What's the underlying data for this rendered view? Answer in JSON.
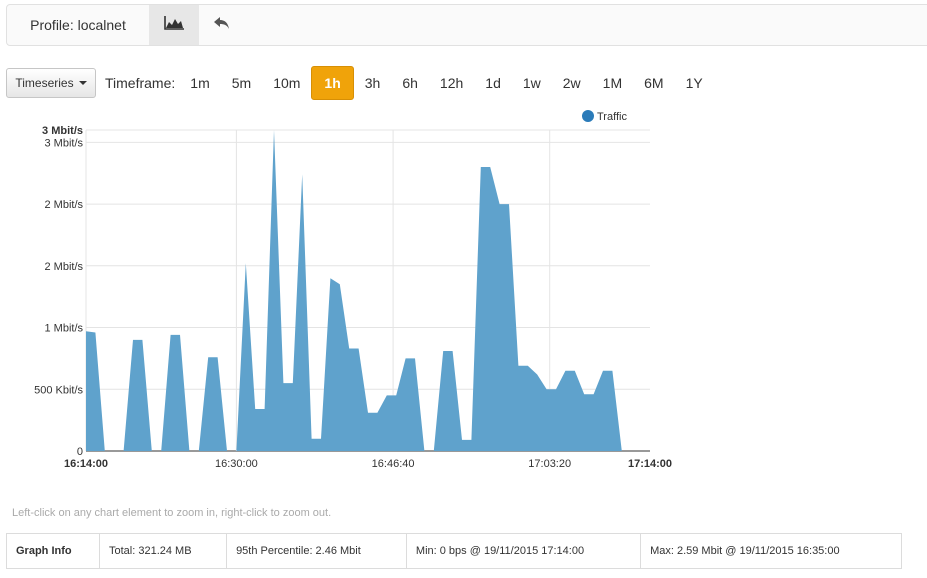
{
  "header": {
    "profile_label": "Profile: localnet",
    "chart_tab_icon": "area-chart-icon",
    "back_icon": "undo-arrow-icon"
  },
  "toolbar": {
    "view_dropdown": "Timeseries",
    "timeframe_label": "Timeframe:",
    "timeframes": [
      "1m",
      "5m",
      "10m",
      "1h",
      "3h",
      "6h",
      "12h",
      "1d",
      "1w",
      "2w",
      "1M",
      "6M",
      "1Y"
    ],
    "selected_timeframe": "1h"
  },
  "colors": {
    "accent": "#f0a30a",
    "series": "#5fa2cc",
    "legend_dot": "#2b7bb9"
  },
  "chart_data": {
    "type": "area",
    "title": "",
    "xlabel": "",
    "ylabel": "",
    "legend": [
      "Traffic"
    ],
    "legend_position": "top-right",
    "grid": true,
    "x_ticks": [
      "16:14:00",
      "16:30:00",
      "16:46:40",
      "17:03:20",
      "17:14:00"
    ],
    "x_tick_bold": [
      true,
      false,
      false,
      false,
      true
    ],
    "y_ticks": [
      "0",
      "500 Kbit/s",
      "1 Mbit/s",
      "2 Mbit/s",
      "2 Mbit/s",
      "3 Mbit/s"
    ],
    "y_max_label": "3 Mbit/s",
    "ylim_bps": [
      0,
      2600000
    ],
    "xlim_minutes": [
      0,
      60
    ],
    "series": [
      {
        "name": "Traffic",
        "x_minutes": [
          0,
          1,
          2,
          3,
          4,
          5,
          6,
          7,
          8,
          9,
          10,
          11,
          12,
          13,
          14,
          15,
          16,
          17,
          18,
          19,
          20,
          21,
          22,
          23,
          24,
          25,
          26,
          27,
          28,
          29,
          30,
          31,
          32,
          33,
          34,
          35,
          36,
          37,
          38,
          39,
          40,
          41,
          42,
          43,
          44,
          45,
          46,
          47,
          48,
          49,
          50,
          51,
          52,
          53,
          54,
          55,
          56,
          57,
          58,
          59,
          60
        ],
        "values_bps": [
          970000,
          960000,
          0,
          0,
          0,
          900000,
          900000,
          0,
          0,
          940000,
          940000,
          0,
          0,
          760000,
          760000,
          0,
          0,
          1520000,
          340000,
          340000,
          2600000,
          550000,
          550000,
          2240000,
          100000,
          100000,
          1400000,
          1350000,
          830000,
          830000,
          310000,
          310000,
          450000,
          450000,
          750000,
          750000,
          0,
          0,
          810000,
          810000,
          90000,
          90000,
          2300000,
          2300000,
          2000000,
          2000000,
          690000,
          690000,
          620000,
          500000,
          500000,
          650000,
          650000,
          460000,
          460000,
          650000,
          650000,
          0,
          0,
          0,
          0
        ]
      }
    ]
  },
  "hint": "Left-click on any chart element to zoom in, right-click to zoom out.",
  "graph_info": {
    "title": "Graph Info",
    "total": "Total: 321.24 MB",
    "percentile": "95th Percentile: 2.46 Mbit",
    "min": "Min: 0 bps @ 19/11/2015 17:14:00",
    "max": "Max: 2.59 Mbit @ 19/11/2015 16:35:00"
  }
}
